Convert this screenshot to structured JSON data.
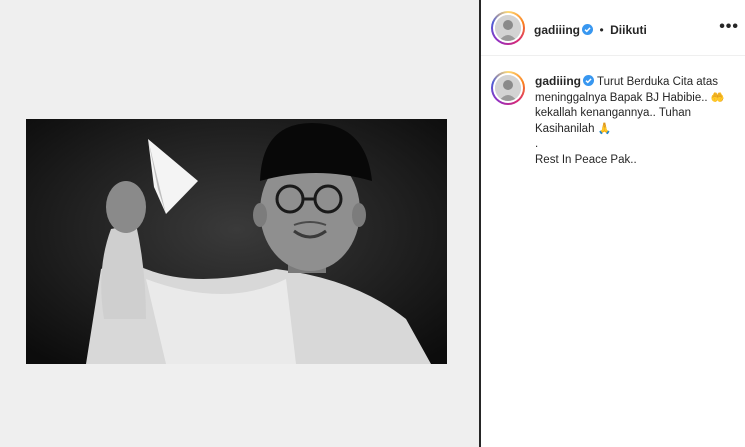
{
  "post": {
    "username": "gadiiing",
    "verified": true,
    "separator": "•",
    "follow_state": "Diikuti",
    "more_glyph": "•••"
  },
  "caption": {
    "username": "gadiiing",
    "line1": "Turut Berduka Cita atas",
    "line2": "meninggalnya Bapak BJ Habibie..",
    "emoji1": "🤲",
    "line3": "kekallah kenangannya.. Tuhan",
    "line4": "Kasihanilah",
    "emoji2": "🙏",
    "line5": ".",
    "line6": "Rest In Peace Pak.."
  },
  "colors": {
    "verified_blue": "#3897f0",
    "text": "#262626",
    "media_bg": "#efefef"
  }
}
